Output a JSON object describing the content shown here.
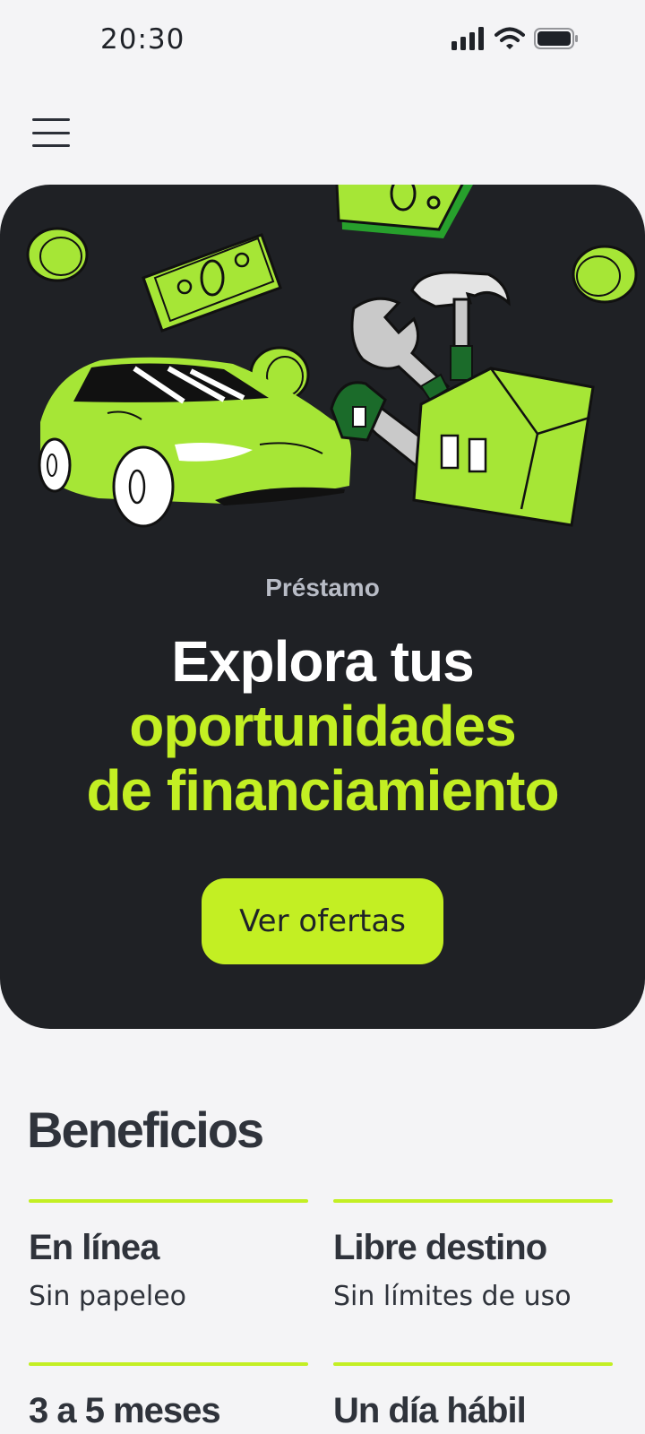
{
  "status_bar": {
    "time": "20:30"
  },
  "hero": {
    "eyebrow": "Préstamo",
    "title_line1": "Explora tus",
    "title_line2": "oportunidades",
    "title_line3": "de financiamiento",
    "cta_label": "Ver ofertas",
    "accent_color": "#c3ef23",
    "background_color": "#1f2125"
  },
  "benefits": {
    "title": "Beneficios",
    "items": [
      {
        "title": "En línea",
        "subtitle": "Sin papeleo"
      },
      {
        "title": "Libre destino",
        "subtitle": "Sin límites de uso"
      },
      {
        "title": "3 a 5 meses",
        "subtitle": ""
      },
      {
        "title": "Un día hábil",
        "subtitle": ""
      }
    ]
  },
  "icons": [
    "menu-icon",
    "signal-icon",
    "wifi-icon",
    "battery-icon"
  ]
}
